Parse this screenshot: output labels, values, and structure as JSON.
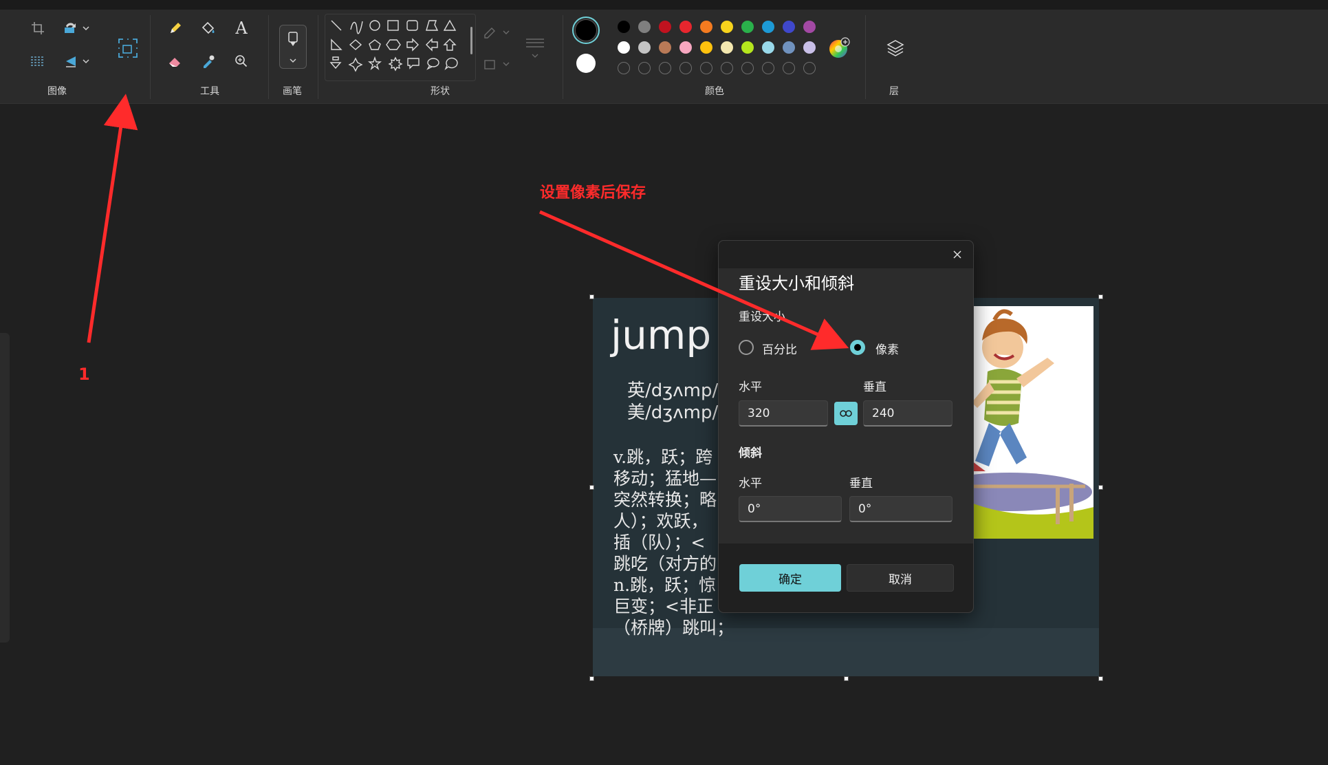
{
  "ribbon": {
    "groups": [
      {
        "label": "图像"
      },
      {
        "label": "工具"
      },
      {
        "label": "画笔"
      },
      {
        "label": "形状"
      },
      {
        "label": "颜色"
      },
      {
        "label": "层"
      }
    ],
    "palette": {
      "primary": "#000000",
      "secondary": "#ffffff",
      "row1": [
        "#000000",
        "#7f7f7f",
        "#c1121f",
        "#e8262e",
        "#f47b20",
        "#f7d31c",
        "#2ab14b",
        "#1d9ad6",
        "#3f48cc",
        "#a349a4"
      ],
      "row2": [
        "#ffffff",
        "#c3c3c3",
        "#b97a57",
        "#f7a7c0",
        "#ffc20e",
        "#f4e8b0",
        "#b5e61d",
        "#99d9ea",
        "#7092be",
        "#c8bfe7"
      ]
    }
  },
  "image": {
    "word": "jump",
    "phonetic_uk": "英/dʒʌmp/",
    "phonetic_us": "美/dʒʌmp/",
    "lines": [
      "v.跳，跃；跨",
      "移动；猛地—",
      "突然转换；略",
      "人）；欢跃，",
      "插（队）；<",
      "跳吃（对方的",
      "n.跳，跃；惊",
      "巨变；<非正",
      "（桥牌）跳叫；"
    ]
  },
  "dialog": {
    "title": "重设大小和倾斜",
    "resize_section": "重设大小",
    "option_percent": "百分比",
    "option_pixels": "像素",
    "selected_option": "像素",
    "horizontal_label": "水平",
    "vertical_label": "垂直",
    "resize_horizontal": "320",
    "resize_vertical": "240",
    "skew_section": "倾斜",
    "skew_horizontal": "0°",
    "skew_vertical": "0°",
    "ok_label": "确定",
    "cancel_label": "取消"
  },
  "annotations": {
    "save_hint": "设置像素后保存",
    "step_number": "1",
    "color": "#ff2b2b"
  }
}
